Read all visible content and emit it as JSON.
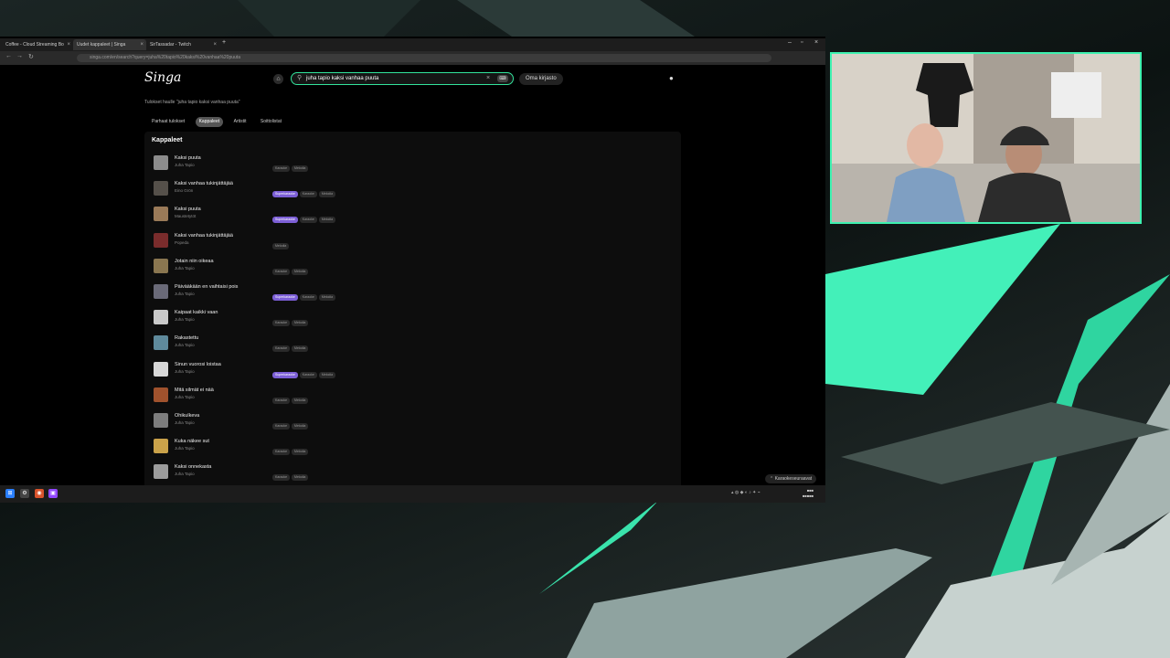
{
  "browser": {
    "tabs": [
      {
        "label": "Coffee - Cloud Streaming Bo",
        "active": false
      },
      {
        "label": "Uudet kappaleet | Singa",
        "active": true
      },
      {
        "label": "SirTassadar - Twitch",
        "active": false
      }
    ],
    "url": "singa.com/en/search?query=juha%20tapio%20kaksi%20vanhaa%20puuta"
  },
  "app": {
    "logo": "Singa",
    "search_value": "juha tapio kaksi vanhaa puuta",
    "library_label": "Oma kirjasto"
  },
  "results": {
    "results_for": "Tulokset haulle \"juha tapio kaksi vanhaa puuta\"",
    "tabs": [
      {
        "label": "Parhaat tulokset",
        "active": false
      },
      {
        "label": "Kappaleet",
        "active": true
      },
      {
        "label": "Artistit",
        "active": false
      },
      {
        "label": "Soittolistat",
        "active": false
      }
    ],
    "section_title": "Kappaleet",
    "songs": [
      {
        "title": "Kaksi puuta",
        "artist": "Juha Tapio",
        "tags": [
          "Karaoke",
          "Melodia"
        ],
        "thumb": "#8c8c8c"
      },
      {
        "title": "Kaksi vanhaa tukinjättäjää",
        "artist": "Eino Grön",
        "tags": [
          "Superkaraoke",
          "Karaoke",
          "Melodia"
        ],
        "thumb": "#55504a"
      },
      {
        "title": "Kaksi puuta",
        "artist": "Maustetytöt",
        "tags": [
          "Superkaraoke",
          "Karaoke",
          "Melodia"
        ],
        "thumb": "#9a7a58"
      },
      {
        "title": "Kaksi vanhaa tukinjättäjää",
        "artist": "Popeda",
        "tags": [
          "Melodia"
        ],
        "thumb": "#7a2c2c"
      },
      {
        "title": "Jotain niin oikeaa",
        "artist": "Juha Tapio",
        "tags": [
          "Karaoke",
          "Melodia"
        ],
        "thumb": "#8a7650"
      },
      {
        "title": "Päivääkään en vaihtaisi pois",
        "artist": "Juha Tapio",
        "tags": [
          "Superkaraoke",
          "Karaoke",
          "Melodia"
        ],
        "thumb": "#6a6a78"
      },
      {
        "title": "Kaipaat kaikki vaan",
        "artist": "Juha Tapio",
        "tags": [
          "Karaoke",
          "Melodia"
        ],
        "thumb": "#c9c9c9"
      },
      {
        "title": "Rakastettu",
        "artist": "Juha Tapio",
        "tags": [
          "Karaoke",
          "Melodia"
        ],
        "thumb": "#5f8a9c"
      },
      {
        "title": "Sinun vuorosi loistaa",
        "artist": "Juha Tapio",
        "tags": [
          "Superkaraoke",
          "Karaoke",
          "Melodia"
        ],
        "thumb": "#d7d7d7"
      },
      {
        "title": "Mitä silmät ei nää",
        "artist": "Juha Tapio",
        "tags": [
          "Karaoke",
          "Melodia"
        ],
        "thumb": "#a0522d"
      },
      {
        "title": "Ohikulkeva",
        "artist": "Juha Tapio",
        "tags": [
          "Karaoke",
          "Melodia"
        ],
        "thumb": "#7d7d7d"
      },
      {
        "title": "Kuka näkee sut",
        "artist": "Juha Tapio",
        "tags": [
          "Karaoke",
          "Melodia"
        ],
        "thumb": "#caa24a"
      },
      {
        "title": "Kaksi onnekasta",
        "artist": "Juha Tapio",
        "tags": [
          "Karaoke",
          "Melodia"
        ],
        "thumb": "#9c9c9c"
      }
    ],
    "karaoke_button": "Karaokeseuraavat"
  },
  "colors": {
    "accent": "#33e39c",
    "superkaraoke": "#7c5fd6",
    "stream_border": "#3ef1b0"
  },
  "icons": [
    "home-icon",
    "search-icon",
    "keyboard-icon",
    "user-icon",
    "windows-icon"
  ]
}
